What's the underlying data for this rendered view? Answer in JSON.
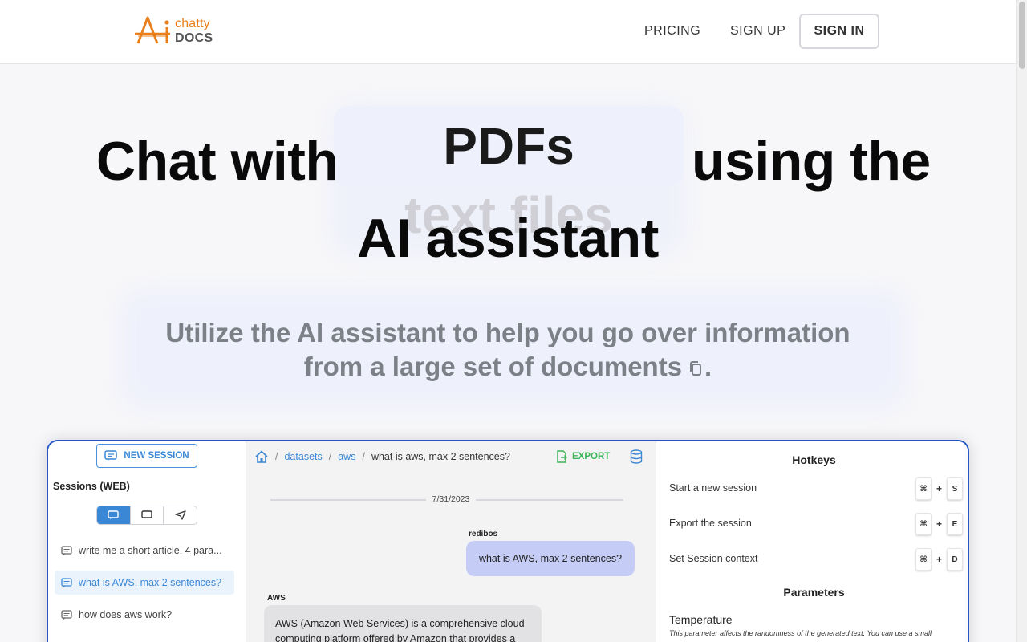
{
  "header": {
    "logo_top": "chatty",
    "logo_bottom": "DOCS",
    "nav_pricing": "PRICING",
    "nav_signup": "SIGN UP",
    "signin": "SIGN IN"
  },
  "hero": {
    "line_start": "Chat with",
    "rotating_current": "PDFs",
    "rotating_next": "text files",
    "line_end": "using the",
    "line_two": "AI assistant",
    "subtitle_1": "Utilize the AI assistant to help you go over information",
    "subtitle_2": "from a large set of documents",
    "subtitle_end": "."
  },
  "preview": {
    "new_session": "NEW SESSION",
    "sessions_title": "Sessions (WEB)",
    "sessions": [
      "write me a short article, 4 para...",
      "what is AWS, max 2 sentences?",
      "how does aws work?"
    ],
    "breadcrumb": {
      "datasets": "datasets",
      "aws": "aws",
      "current": "what is aws, max 2 sentences?"
    },
    "export": "EXPORT",
    "date": "7/31/2023",
    "user_name": "redibos",
    "user_message": "what is AWS, max 2 sentences?",
    "ai_name": "AWS",
    "ai_message": "AWS (Amazon Web Services) is a comprehensive cloud computing platform offered by Amazon that provides a",
    "hotkeys_title": "Hotkeys",
    "hotkeys": [
      {
        "label": "Start a new session",
        "mod": "⌘",
        "key": "S"
      },
      {
        "label": "Export the session",
        "mod": "⌘",
        "key": "E"
      },
      {
        "label": "Set Session context",
        "mod": "⌘",
        "key": "D"
      }
    ],
    "parameters_title": "Parameters",
    "temperature_title": "Temperature",
    "temperature_desc": "This parameter affects the randomness of the generated text. You can use a small"
  },
  "colors": {
    "accent_blue": "#3a87d6",
    "brand_orange": "#e8801e",
    "export_green": "#3cb55a",
    "user_bubble": "#c5cdf7"
  }
}
